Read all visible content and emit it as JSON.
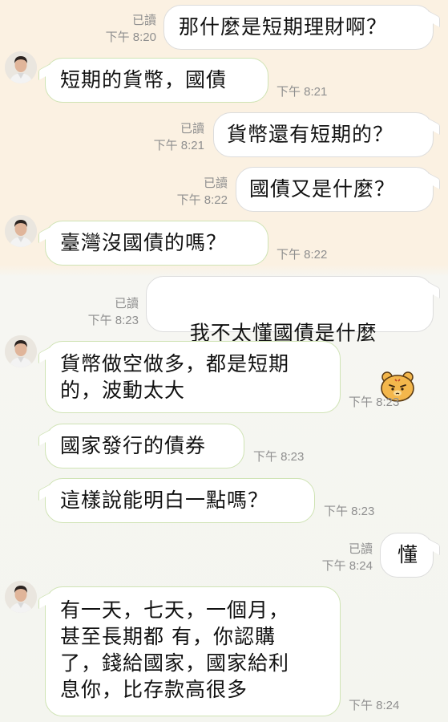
{
  "messages": [
    {
      "dir": "out",
      "text": "那什麼是短期理財啊？",
      "read": "已讀",
      "time": "下午 8:20"
    },
    {
      "dir": "in",
      "text": "短期的貨幣，國債",
      "time": "下午 8:21"
    },
    {
      "dir": "out",
      "text": "貨幣還有短期的？",
      "read": "已讀",
      "time": "下午 8:21"
    },
    {
      "dir": "out",
      "text": "國債又是什麼？",
      "read": "已讀",
      "time": "下午 8:22"
    },
    {
      "dir": "in",
      "text": "臺灣沒國債的嗎？",
      "time": "下午 8:22"
    },
    {
      "dir": "out",
      "text": "我不太懂國債是什麼",
      "read": "已讀",
      "time": "下午 8:23",
      "sticker": "grumpy-bear-emoji"
    },
    {
      "dir": "in",
      "text": "貨幣做空做多，都是短期\n的，波動太大",
      "time": "下午 8:23"
    },
    {
      "dir": "in",
      "text": "國家發行的債券",
      "time": "下午 8:23"
    },
    {
      "dir": "in",
      "text": "這樣說能明白一點嗎？",
      "time": "下午 8:23"
    },
    {
      "dir": "out",
      "text": "懂",
      "read": "已讀",
      "time": "下午 8:24"
    },
    {
      "dir": "in",
      "text": "有一天，七天，一個月，\n甚至長期都 有，你認購\n了，錢給國家，國家給利\n息你，比存款高很多",
      "time": "下午 8:24"
    }
  ],
  "colors": {
    "bg_top": "#fbf1e2",
    "bg_bottom": "#f4f5ef",
    "incoming_border": "#cfe3b4",
    "outgoing_border": "#dcdcdc",
    "meta_text": "#8f8f8f"
  },
  "icons": {
    "avatar": "contact-avatar",
    "sticker": "grumpy-bear-emoji"
  }
}
